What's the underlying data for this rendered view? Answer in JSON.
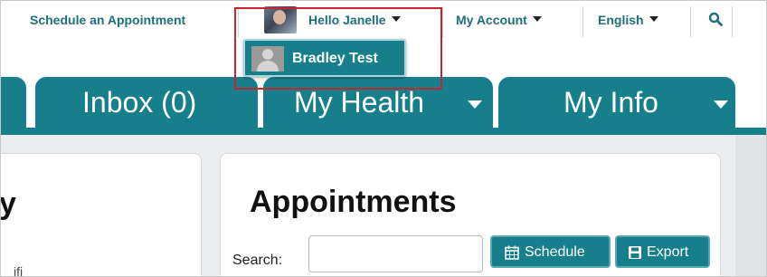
{
  "topbar": {
    "schedule_link": "Schedule an Appointment",
    "user_menu": "Hello Janelle",
    "account_menu": "My Account",
    "language_menu": "English",
    "search_icon": "search-icon"
  },
  "dropdown": {
    "items": [
      {
        "label": "Bradley Test",
        "icon": "user-silhouette"
      }
    ]
  },
  "tabs": [
    {
      "label": "Inbox (0)",
      "has_caret": false
    },
    {
      "label": "My Health",
      "has_caret": true
    },
    {
      "label": "My Info",
      "has_caret": true
    }
  ],
  "left_panel": {
    "title_fragment": "y",
    "text_fragment": "ifi"
  },
  "appointments": {
    "title": "Appointments",
    "search_label": "Search:",
    "search_value": "",
    "schedule_button": "Schedule",
    "export_button": "Export"
  },
  "colors": {
    "accent": "#177f8c",
    "link": "#1f6f7e",
    "highlight_border": "#c4262e"
  }
}
